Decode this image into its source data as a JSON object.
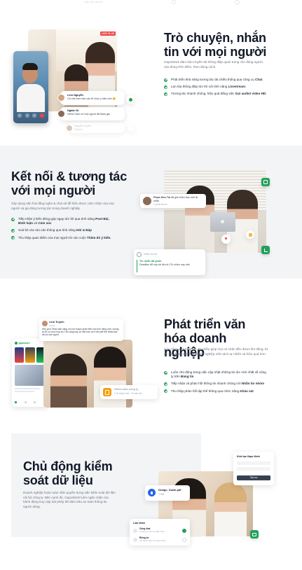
{
  "top_nav": {
    "faded_label": "Sắp xếp nhanh"
  },
  "colors": {
    "brand_green": "#22a05b",
    "live_red": "#ef4444",
    "band_gray": "#f3f4f6",
    "text_dark": "#111827"
  },
  "section_chat": {
    "title": "Trò chuyện, nhắn tin với mọi người",
    "desc": "GapoWork đảm bảo truyền tải thông điệp quan trọng cho đúng người, vào đúng thời điểm, theo đúng cách.",
    "bullets": [
      {
        "pre": "Phát triển khả năng tương tác đa chiều thông qua công cụ ",
        "bold": "Chat",
        "post": "."
      },
      {
        "pre": "Lan tỏa thông điệp tức thì với tính năng ",
        "bold": "Livestream",
        "post": "."
      },
      {
        "pre": "Tương tác nhanh chóng, hiệu quả bằng việc ",
        "bold": "Gọi audio/ video HD",
        "post": "."
      }
    ],
    "live_badge": "LIVE 01:26",
    "messages": [
      {
        "name": "Linn Nguyễn",
        "text": "Cả nhà xem báo cáo tổ chức ý kiến nhé 😊"
      },
      {
        "name": "Nghĩa Vũ",
        "text": "Hehe! Cảm ơn mọi người đã tham gia"
      },
      {
        "name": "Nguyễn Huyền",
        "text": "Nhất trí"
      }
    ]
  },
  "section_connect": {
    "title": "Kết nối & tương tác với mọi người",
    "desc": "Xây dựng văn hóa lắng nghe & chia sẻ để hiểu được cảm nhận của mọi người và gia tăng tương tác trong doanh nghiệp.",
    "bullets": [
      {
        "pre": "Tiếp nhận ý kiến đóng góp ngay tức thì qua tính năng ",
        "bold": "Post Bài, Bình luận",
        "mid": " và ",
        "bold2": "Cảm xúc",
        "post": ""
      },
      {
        "pre": "Xoá bỏ các rào cản thông qua tính năng ",
        "bold": "Hỏi & Đáp",
        "mid": "",
        "bold2": "",
        "post": ""
      },
      {
        "pre": "Thu thập quan điểm của mọi người từ các cuộc ",
        "bold": "Thăm dò ý kiến",
        "mid": "",
        "bold2": "",
        "post": "."
      }
    ],
    "post_card": {
      "name": "Phạm Hồn Tài",
      "text": "đã giới thiệu bạn một tin nhắn",
      "time": "2 phút trước"
    },
    "reply_placeholder": "Nhắn dự án",
    "deadline_card": {
      "title": "Tin nhắn đã ghim",
      "text": "Deadline để nộp tài liệu là 17h chiều nay nhé"
    }
  },
  "section_culture": {
    "title": "Phát triển văn hóa doanh nghiệp",
    "desc": "Các công cụ tương tác đa chiều giúp mọi cá nhân đều được lên tiếng, từ đó xây dựng văn hóa doanh nghiệp một cách tự nhiên và hiệu quả hơn.",
    "bullets": [
      {
        "pre": "Luôn chủ động trong việc cập nhật những tin tức mới nhất về công ty trên ",
        "bold": "Bảng tin",
        "post": ""
      },
      {
        "pre": "Tiếp nhận và phản hồi thông tin nhanh chóng với ",
        "bold": "Nhắn tin nhóm",
        "post": ""
      },
      {
        "pre": "Thu thập phản hồi tập thể thông qua chức năng ",
        "bold": "Khảo sát",
        "post": ""
      }
    ],
    "feed_post": {
      "name": "Linh Truyền",
      "time": "3 phút",
      "text": "Hey yoo! Team sẵn sàng cho kế hoạch phát triển các tính năng mới, chúng ta sẽ có cuộc họp lúc 10h sáng hay về dẫn bạn và ở đã phế thế Welcome tất cả mọi người"
    },
    "group_card": {
      "title": "Nhóm toàn công ty",
      "sub": "1.2k thành viên · 32 bài mới"
    },
    "phone": {
      "brand": "gapowork"
    }
  },
  "section_data": {
    "title": "Chủ động kiểm soát dữ liệu",
    "desc": "Doanh nghiệp hoàn toàn nắm quyền trong việc kiểm soát dữ liệu nội bộ công ty. Bên cạnh đó, GapoWork luôn ngăn chặn các hành động truy cập trái phép để đảm bảo an toàn thông tin người dùng.",
    "file_card": {
      "name": "Design_Guide.pdf",
      "size": "1 MB"
    },
    "workspace_card": {
      "title": "Khởi tạo Gapo Work",
      "button": "Tiếp tục"
    },
    "security_card": {
      "title": "Loại nhóm",
      "options": [
        {
          "label": "Công khai",
          "sub": "Ai cũng có thể tìm thấy nhóm"
        },
        {
          "label": "Riêng tư",
          "sub": "Chỉ thành viên mới thấy nhóm"
        }
      ]
    }
  }
}
